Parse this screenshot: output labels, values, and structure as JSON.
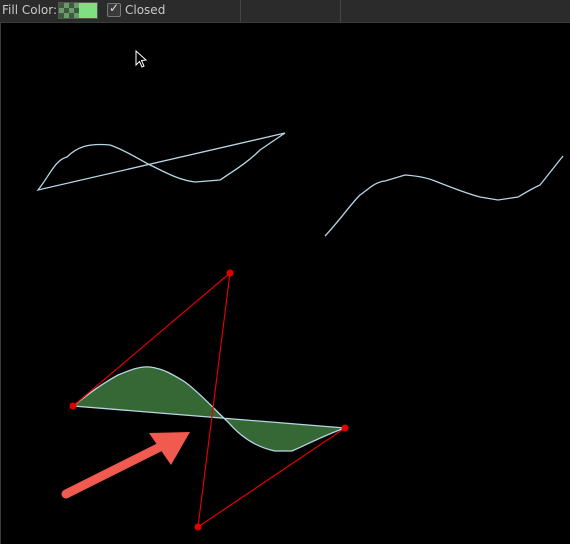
{
  "toolbar": {
    "fill_color_label": "Fill Color:",
    "fill_color": "#7ee081",
    "closed_label": "Closed",
    "closed_checked": true,
    "checkmark_glyph": "✓"
  },
  "canvas": {
    "background": "#000000",
    "stroke_color": "#b8d6e6",
    "control_color": "#e00000",
    "fill_color": "#3f7a3f",
    "arrow_color": "#f05a4f"
  }
}
